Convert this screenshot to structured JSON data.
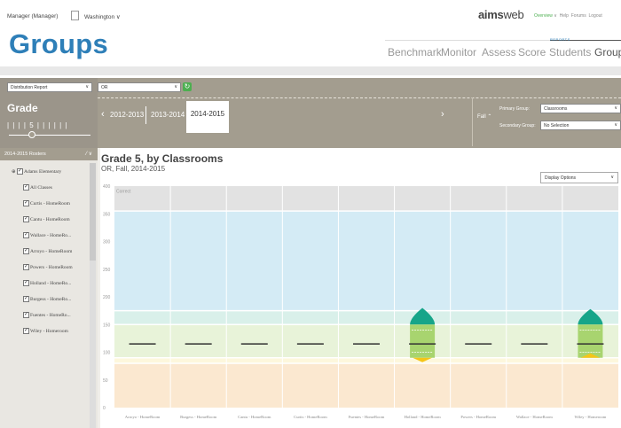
{
  "header": {
    "user": "Manager (Manager)",
    "location": "Washington",
    "logo_bold": "aims",
    "logo_rest": "web",
    "links": {
      "overview": "Overview",
      "help": "Help",
      "forums": "Forums",
      "logout": "Logout"
    }
  },
  "page_title": "Groups",
  "nav": {
    "reports_label": "REPORTS",
    "items": [
      "Benchmark",
      "Monitor",
      "Assess",
      "Score",
      "Students",
      "Groups"
    ]
  },
  "toolbar": {
    "report_select": "Distribution Report",
    "state_select": "OR",
    "grade_label": "Grade",
    "grade_value": "5",
    "years": [
      "2012-2013",
      "2013-2014",
      "2014-2015"
    ],
    "selected_year": "2014-2015",
    "season": "Fall",
    "primary_group_label": "Primary Group:",
    "primary_group_value": "Classrooms",
    "secondary_group_label": "Secondary Group:",
    "secondary_group_value": "No Selection"
  },
  "sidebar": {
    "title": "2014-2015 Rosters",
    "school": "Adams Elementary",
    "items": [
      "All Classes",
      "Curtis - HomeRoom",
      "Cantu - HomeRoom",
      "Wallace - HomeRo...",
      "Arroyo - HomeRoom",
      "Powers - HomeRoom",
      "Holland - HomeRo...",
      "Burgess - HomeRo...",
      "Fuentes - HomeRo...",
      "Wiley - Homeroom"
    ]
  },
  "chart": {
    "title": "Grade 5, by Classrooms",
    "subtitle": "OR, Fall, 2014-2015",
    "display_options": "Display Options",
    "top_band_label": "Correct"
  },
  "chart_data": {
    "type": "box",
    "ylim": [
      0,
      400
    ],
    "yticks": [
      0,
      50,
      100,
      150,
      200,
      250,
      300,
      350,
      400
    ],
    "categories": [
      "Arroyo - HomeRoom",
      "Burgess - HomeRoom",
      "Cantu - HomeRoom",
      "Curtis - HomeRoom",
      "Fuentes - HomeRoom",
      "Holland - HomeRoom",
      "Powers - HomeRoom",
      "Wallace - HomeRoom",
      "Wiley - Homeroom"
    ],
    "medians": [
      115,
      115,
      115,
      115,
      115,
      115,
      115,
      115,
      115
    ],
    "distributions": [
      {
        "category": "Holland - HomeRoom",
        "low": 82,
        "high": 180
      },
      {
        "category": "Wiley - Homeroom",
        "low": 98,
        "high": 178
      }
    ],
    "bands": [
      {
        "from": 0,
        "to": 80,
        "color": "#fbe8d0"
      },
      {
        "from": 80,
        "to": 90,
        "color": "#fdf7dc"
      },
      {
        "from": 90,
        "to": 150,
        "color": "#e8f3d9"
      },
      {
        "from": 150,
        "to": 175,
        "color": "#d9f0ea"
      },
      {
        "from": 175,
        "to": 355,
        "color": "#d4ebf5"
      },
      {
        "from": 355,
        "to": 400,
        "color": "#e2e2e2"
      }
    ],
    "colors": {
      "top": "#17a589",
      "middle": "#a8d46f",
      "bottom": "#f5c518"
    }
  }
}
